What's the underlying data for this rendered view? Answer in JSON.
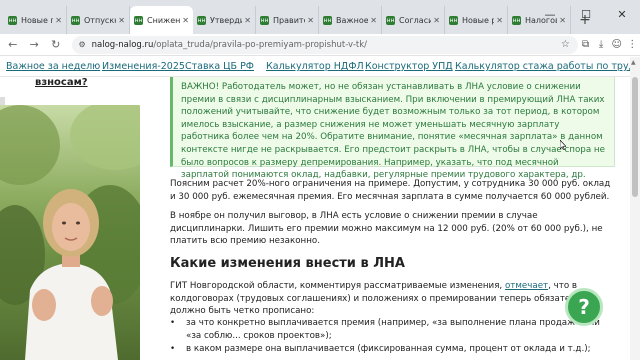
{
  "browser": {
    "tabs": [
      {
        "label": "Новые прав",
        "active": false
      },
      {
        "label": "Отпускные",
        "active": false
      },
      {
        "label": "Снижени",
        "active": true
      },
      {
        "label": "Утвердили",
        "active": false
      },
      {
        "label": "Правитель",
        "active": false
      },
      {
        "label": "Важное уто",
        "active": false
      },
      {
        "label": "Согласие н",
        "active": false
      },
      {
        "label": "Новые реко",
        "active": false
      },
      {
        "label": "Налоговые",
        "active": false
      }
    ],
    "url_host": "nalog-nalog.ru",
    "url_path": "/oplata_truda/pravila-po-premiyam-propishut-v-tk/"
  },
  "site_nav": [
    {
      "label": "Важное за неделю"
    },
    {
      "label": "Изменения-2025"
    },
    {
      "label": "Ставка ЦБ РФ"
    },
    {
      "label": "Калькулятор НДФЛ"
    },
    {
      "label": "Конструктор УПД"
    },
    {
      "label": "Калькулятор стажа работы по трудово"
    }
  ],
  "sidebar": {
    "fragment": "взносам?"
  },
  "main": {
    "callout": "ВАЖНО! Работодатель может, но не обязан устанавливать в ЛНА условие о снижении премии в связи с дисциплинарным взысканием. При включении в премирующий ЛНА таких положений учитывайте, что снижение будет возможным только за тот период, в котором имелось взыскание, а размер снижения не может уменьшать месячную зарплату работника более чем на 20%. Обратите внимание, понятие «месячная зарплата» в данном контексте нигде не раскрывается. Его предстоит раскрыть в ЛНА, чтобы в случае спора не было вопросов к размеру депремирования. Например, указать, что под месячной зарплатой понимаются оклад, надбавки, регулярные премии трудового характера, др.",
    "para1": "Поясним расчет 20%-ного ограничения на примере. Допустим, у сотрудника 30 000 руб. оклад и 30 000 руб. ежемесячная премия. Его месячная зарплата в сумме получается 60 000 рублей.",
    "para2": "В ноябре он получил выговор, в ЛНА есть условие о снижении премии в случае дисциплинарки. Лишить его премии можно максимум на 12 000 руб. (20% от 60 000 руб.), не платить всю премию незаконно.",
    "heading": "Какие изменения внести в ЛНА",
    "para3_before": "ГИТ Новгородской области, комментируя рассматриваемые изменения, ",
    "para3_link": "отмечает",
    "para3_after": ", что в колдоговорах (трудовых соглашениях) и положениях о премировании теперь обязательно должно быть четко прописано:",
    "bullets": [
      "за что конкретно выплачивается премия (например, «за выполнение плана продаж» или «за соблю... сроков проектов»);",
      "в каком размере она выплачивается (фиксированная сумма, процент от оклада и т.д.);"
    ]
  },
  "help_button": {
    "label": "?"
  }
}
